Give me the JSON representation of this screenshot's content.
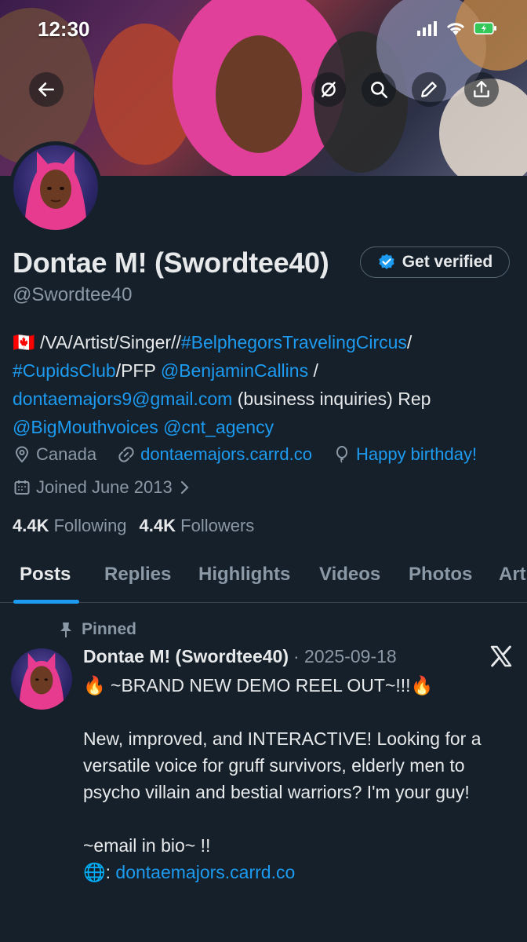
{
  "status_bar": {
    "time": "12:30"
  },
  "profile": {
    "display_name": "Dontae M! (Swordtee40)",
    "verify_label": "Get verified",
    "handle": "@Swordtee40",
    "bio": {
      "flag": "🇨🇦",
      "text1": " /VA/Artist/Singer//",
      "hashtag1": "#BelphegorsTravelingCircus",
      "text2": "/",
      "hashtag2": "#CupidsClub",
      "text3": "/PFP ",
      "mention1": "@BenjaminCallins",
      "text4": " /",
      "email": "dontaemajors9@gmail.com",
      "text5": " (business inquiries) Rep",
      "mention2": "@BigMouthvoices",
      "text6": " ",
      "mention3": "@cnt_agency"
    },
    "location": "Canada",
    "website": "dontaemajors.carrd.co",
    "birthday": "Happy birthday!",
    "joined": "Joined June 2013",
    "following_count": "4.4K",
    "following_label": "Following",
    "followers_count": "4.4K",
    "followers_label": "Followers"
  },
  "tabs": [
    "Posts",
    "Replies",
    "Highlights",
    "Videos",
    "Photos",
    "Art"
  ],
  "post": {
    "pinned_label": "Pinned",
    "author": "Dontae M! (Swordtee40)",
    "date": "· 2025-09-18",
    "line1": "🔥 ~BRAND NEW DEMO REEL OUT~!!!🔥",
    "line2": "New, improved, and INTERACTIVE! Looking for a versatile voice for gruff survivors, elderly men to psycho villain and bestial warriors? I'm your guy!",
    "line3": "~email in bio~ !!",
    "link_prefix": "🌐: ",
    "link": "dontaemajors.carrd.co"
  },
  "colors": {
    "accent": "#1d9bf0",
    "background": "#15202b",
    "muted": "#8b98a5"
  }
}
